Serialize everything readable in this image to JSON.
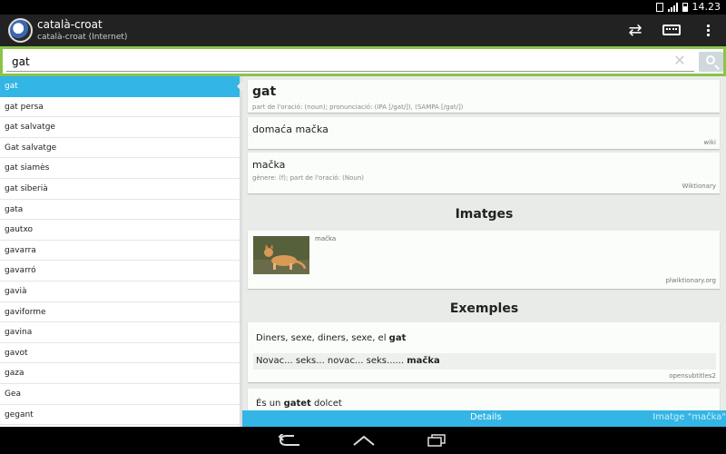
{
  "status_bar": {
    "time": "14.23"
  },
  "action_bar": {
    "title": "català-croat",
    "subtitle": "català-croat (Internet)"
  },
  "search": {
    "value": "gat"
  },
  "word_list": [
    "gat",
    "gat persa",
    "gat salvatge",
    "Gat salvatge",
    "gat siamès",
    "gat siberià",
    "gata",
    "gautxo",
    "gavarra",
    "gavarró",
    "gavià",
    "gaviforme",
    "gavina",
    "gavot",
    "gaza",
    "Gea",
    "gegant"
  ],
  "selected_index": 0,
  "entry": {
    "headword": "gat",
    "headword_meta": "part de l'oració: (noun); pronunciació: (IPA [/gat/]), (SAMPA [/gat/])",
    "translations": [
      {
        "text": "domaća mačka",
        "meta": "",
        "source": "wiki"
      },
      {
        "text": "mačka",
        "meta": "gènere: (f); part de l'oració: (Noun)",
        "source": "Wiktionary"
      }
    ]
  },
  "images_section": {
    "heading": "Imatges",
    "caption": "mačka",
    "source": "plwiktionary.org"
  },
  "examples_section": {
    "heading": "Exemples",
    "ex1_pre": "Diners, sexe, diners, sexe, el ",
    "ex1_bold": "gat",
    "ex1_trans_pre": "Novac... seks... novac... seks...... ",
    "ex1_trans_bold": "mačka",
    "ex1_source": "opensubtitles2",
    "ex2_pre": "És un ",
    "ex2_bold": "gatet",
    "ex2_post": " dolcet"
  },
  "bottom_tabs": {
    "details": "Details",
    "image": "Imatge \"mačka\""
  },
  "colors": {
    "accent": "#33b5e5",
    "search_border": "#8bc34a",
    "action_bar": "#222222"
  },
  "icons": [
    "swap-icon",
    "keyboard-icon",
    "overflow-menu-icon",
    "clear-icon",
    "search-icon",
    "back-icon",
    "home-icon",
    "recents-icon"
  ]
}
